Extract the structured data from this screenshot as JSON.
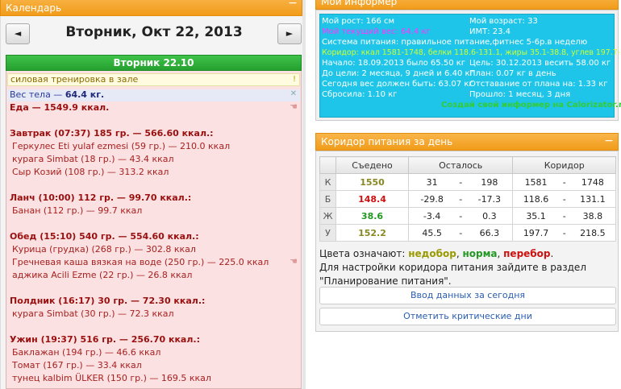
{
  "calendar": {
    "header": "Календарь",
    "minus": "−",
    "prev": "◄",
    "next": "►",
    "title": "Вторник, Окт 22, 2013",
    "day_header": "Вторник 22.10",
    "workout": "силовая тренировка в зале",
    "workout_mark": "!",
    "weight_label": "Вес тела — ",
    "weight_value": "64.4 кг.",
    "food_total": "Еда — 1549.9 ккал.",
    "meals": [
      {
        "title": "Завтрак (07:37) 185 гр. — 566.60 ккал.:",
        "items": [
          "Геркулес Eti yulaf ezmesi (59 гр.) — 210.0 ккал",
          "курага Simbat (18 гр.) — 43.4 ккал",
          "Сыр Козий (108 гр.) — 313.2 ккал"
        ]
      },
      {
        "title": "Ланч (10:00) 112 гр. — 99.70 ккал.:",
        "items": [
          "Банан (112 гр.) — 99.7 ккал"
        ]
      },
      {
        "title": "Обед (15:10) 540 гр. — 554.60 ккал.:",
        "items": [
          "Курица (грудка) (268 гр.) — 302.8 ккал",
          "Гречневая каша вязкая на воде (250 гр.) — 225.0 ккал",
          "аджика Acili Ezme (22 гр.) — 26.8 ккал"
        ]
      },
      {
        "title": "Полдник (16:17) 30 гр. — 72.30 ккал.:",
        "items": [
          "курага Simbat (30 гр.) — 72.3 ккал"
        ]
      },
      {
        "title": "Ужин (19:37) 516 гр. — 256.70 ккал.:",
        "items": [
          "Баклажан (194 гр.) — 46.6 ккал",
          "Томат (167 гр.) — 33.4 ккал",
          "тунец kalbim ÜLKER (150 гр.) — 169.5 ккал"
        ]
      }
    ]
  },
  "informer": {
    "header": "Мой информер",
    "left": [
      "Мой рост: 166 см",
      "Мой текущий вес: 64.4 кг",
      "Система питания: правильное питание,фитнес 5-6р.в неделю",
      "Коридор: ккал 1581-1748, белки 118.6-131.1, жиры 35.1-38.8, углев 197.7-218.5",
      "Начало: 18.09.2013 было 65.50 кг",
      "До цели: 2 месяца, 9 дней и 6.40 кг",
      "Сегодня вес должен быть: 63.07 кг",
      "Сбросила: 1.10 кг"
    ],
    "right": [
      "Мой возраст: 33",
      "ИМТ: 23.4",
      "Цель: 30.12.2013 весить 58.00 кг",
      "План: 0.07 кг в день",
      "Отставание от плана на: 1.33 кг",
      "Прошло: 1 месяц, 3 дня"
    ],
    "link": "Создай свой информер на Calorizator.ru"
  },
  "corridor": {
    "header": "Коридор питания за день",
    "minus": "−",
    "columns": [
      "Съедено",
      "Осталось",
      "Коридор"
    ],
    "rows": [
      {
        "label": "К",
        "eaten": "1550",
        "eaten_class": "olive",
        "left_min": "31",
        "left_max": "198",
        "cor_min": "1581",
        "cor_max": "1748"
      },
      {
        "label": "Б",
        "eaten": "148.4",
        "eaten_class": "red",
        "left_min": "-29.8",
        "left_max": "-17.3",
        "cor_min": "118.6",
        "cor_max": "131.1"
      },
      {
        "label": "Ж",
        "eaten": "38.6",
        "eaten_class": "green",
        "left_min": "-3.4",
        "left_max": "0.3",
        "cor_min": "35.1",
        "cor_max": "38.8"
      },
      {
        "label": "У",
        "eaten": "152.2",
        "eaten_class": "olive",
        "left_min": "45.5",
        "left_max": "66.3",
        "cor_min": "197.7",
        "cor_max": "218.5"
      }
    ],
    "legend_prefix": "Цвета означают: ",
    "legend_under": "недобор",
    "legend_norm": "норма",
    "legend_over": "перебор",
    "legend_text": "Для настройки коридора питания зайдите в раздел \"Планирование питания\".",
    "button_enter": "Ввод данных за сегодня",
    "button_critical": "Отметить критические дни"
  }
}
